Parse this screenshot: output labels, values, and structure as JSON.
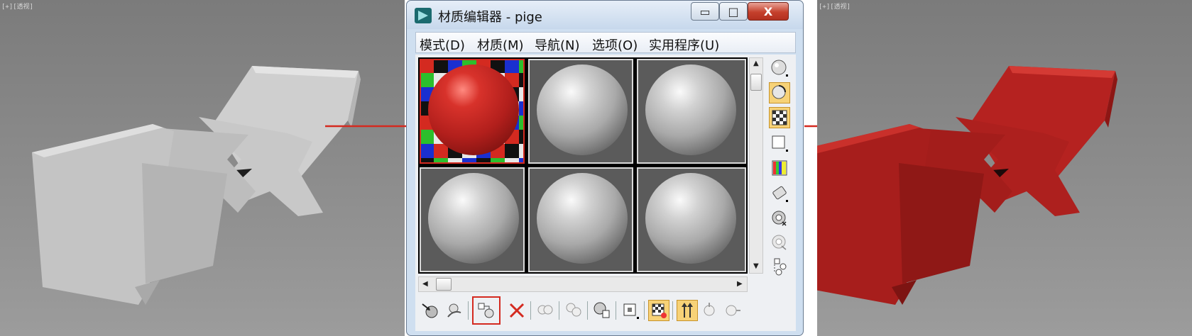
{
  "viewport_left": {
    "label": "[+][透视]"
  },
  "viewport_right": {
    "label": "[+][透视]"
  },
  "editor": {
    "title": "材质编辑器 - pige",
    "menu": [
      "模式(D)",
      "材质(M)",
      "导航(N)",
      "选项(O)",
      "实用程序(U)"
    ],
    "caption_buttons": {
      "minimize": "▭",
      "maximize": "□",
      "close": "X"
    },
    "slots": [
      {
        "id": 1,
        "material": "red-checker",
        "active": true
      },
      {
        "id": 2,
        "material": "gray",
        "active": false
      },
      {
        "id": 3,
        "material": "gray",
        "active": false
      },
      {
        "id": 4,
        "material": "gray",
        "active": false
      },
      {
        "id": 5,
        "material": "gray",
        "active": false
      },
      {
        "id": 6,
        "material": "gray",
        "active": false
      }
    ],
    "side_tools": [
      "sample-type-icon",
      "backlight-icon",
      "background-checker-icon",
      "sample-uv-tiling-icon",
      "video-color-check-icon",
      "make-preview-icon",
      "options-icon",
      "select-by-material-icon",
      "material-map-navigator-icon"
    ],
    "bottom_tools": [
      "get-material-icon",
      "put-material-icon",
      "assign-material-icon",
      "reset-map-icon",
      "make-unique-icon",
      "put-to-library-icon",
      "material-id-channel-icon",
      "show-map-in-viewport-icon",
      "show-end-result-icon",
      "go-to-parent-icon",
      "go-forward-icon"
    ],
    "highlighted_tool": "assign-material-icon"
  },
  "colors": {
    "accent_red": "#d42a20",
    "material_red": "#b8221f",
    "chair_gray": "#c9c9c9"
  }
}
